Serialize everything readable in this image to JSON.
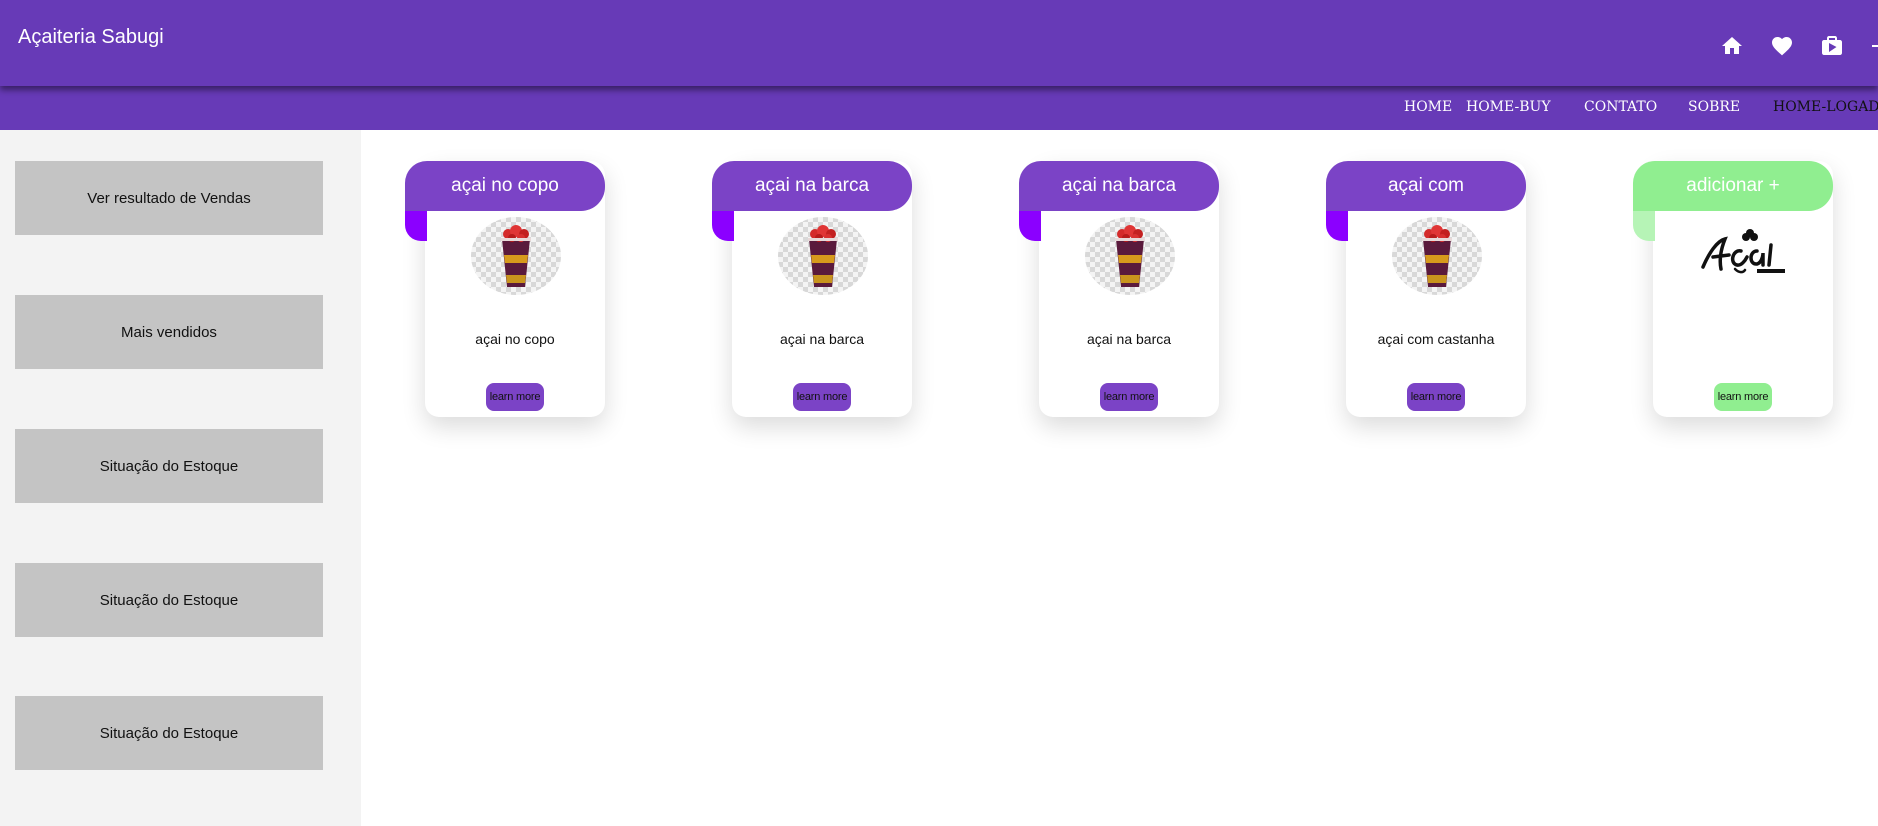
{
  "app": {
    "title": "Açaiteria Sabugi"
  },
  "colors": {
    "primary": "#673ab7",
    "ribbon_purple": "#7b43c6",
    "ribbon_tail_purple": "#8b00ff",
    "ribbon_green": "#90ee90",
    "sidebar_button": "#c4c4c4"
  },
  "header": {
    "icons": [
      {
        "name": "home-icon"
      },
      {
        "name": "heart-icon"
      },
      {
        "name": "shopping-bag-icon"
      },
      {
        "name": "login-icon"
      }
    ]
  },
  "nav": {
    "links": [
      "HOME",
      "HOME-BUY",
      "CONTATO",
      "SOBRE",
      "HOME-LOGADO"
    ]
  },
  "sidebar": {
    "buttons": [
      "Ver resultado de Vendas",
      "Mais vendidos",
      "Situação do Estoque",
      "Situação do Estoque",
      "Situação do Estoque"
    ]
  },
  "cards": [
    {
      "ribbon": "açai no copo",
      "name": "açai no copo",
      "button": "learn more",
      "variant": "purple",
      "image": "acai-cup"
    },
    {
      "ribbon": "açai na barca",
      "name": "açai na barca",
      "button": "learn more",
      "variant": "purple",
      "image": "acai-cup"
    },
    {
      "ribbon": "açai na barca",
      "name": "açai na barca",
      "button": "learn more",
      "variant": "purple",
      "image": "acai-cup"
    },
    {
      "ribbon": "açai com",
      "name": "açai com castanha",
      "button": "learn more",
      "variant": "purple",
      "image": "acai-cup"
    },
    {
      "ribbon": "adicionar +",
      "name": "",
      "button": "learn more",
      "variant": "green",
      "image": "acai-delivery-logo"
    }
  ]
}
